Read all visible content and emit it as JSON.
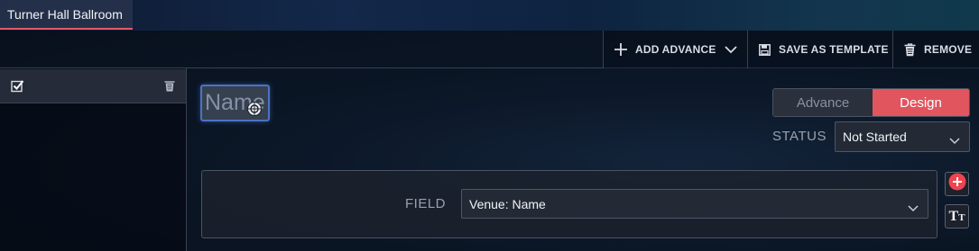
{
  "tab": {
    "title": "Turner Hall Ballroom"
  },
  "toolbar": {
    "add_advance": "ADD ADVANCE",
    "save_as_template": "SAVE AS TEMPLATE",
    "remove": "REMOVE"
  },
  "editor": {
    "name_value": "Name",
    "toggle": {
      "advance": "Advance",
      "design": "Design",
      "active": "Design"
    },
    "status": {
      "label": "STATUS",
      "value": "Not Started"
    },
    "field": {
      "label": "FIELD",
      "value": "Venue: Name"
    }
  },
  "colors": {
    "accent": "#e1555e",
    "focus": "#4b72c6"
  },
  "icons": {
    "add": "plus-icon",
    "chevron": "chevron-down-icon",
    "save": "floppy-disk-icon",
    "remove": "trash-icon",
    "check": "checkbox-checked-icon",
    "add_field": "plus-circle-icon",
    "text_format": "text-format-icon"
  }
}
